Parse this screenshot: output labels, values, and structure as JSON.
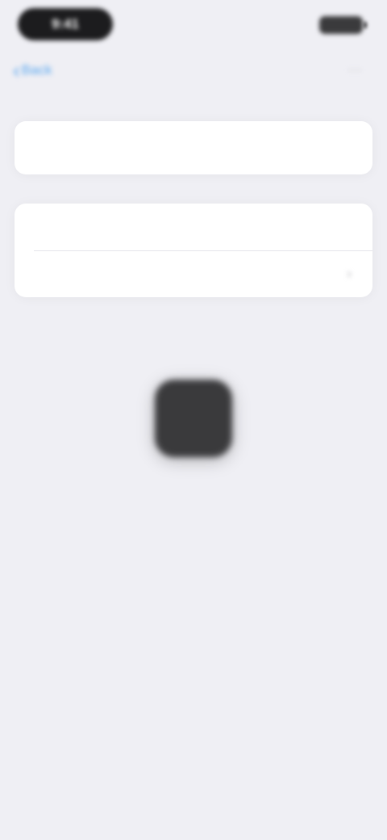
{
  "status_bar": {
    "time": "9:41"
  },
  "nav": {
    "back_label": "Back",
    "title": "",
    "right_icon": "ellipsis-icon"
  },
  "group_1": {
    "row_1_label": ""
  },
  "group_2": {
    "row_1_label": "",
    "row_2_label": "",
    "row_2_value": "",
    "row_2_icon": "chevron-right-icon"
  },
  "footer": {
    "text": "",
    "link": ""
  },
  "app": {
    "caption": ""
  },
  "colors": {
    "background": "#efeff4",
    "accent": "#5aa7f0",
    "card": "#ffffff",
    "icon_dark": "#3a3a3c"
  }
}
